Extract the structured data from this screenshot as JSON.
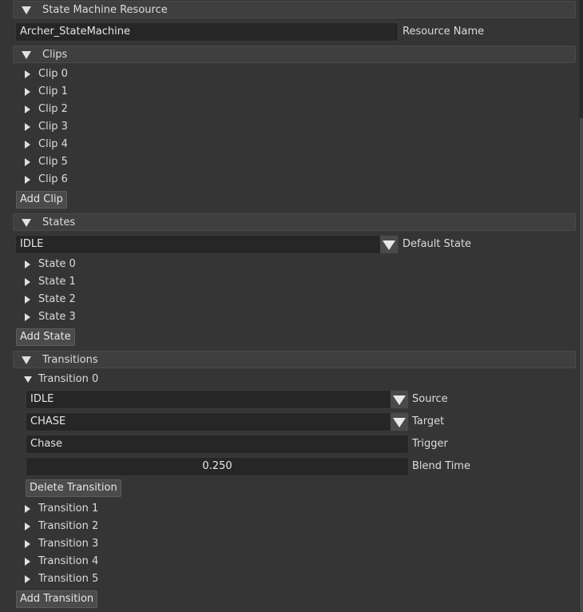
{
  "sections": {
    "resource": {
      "title": "State Machine Resource",
      "name_value": "Archer_StateMachine",
      "name_label": "Resource Name"
    },
    "clips": {
      "title": "Clips",
      "items": [
        "Clip 0",
        "Clip 1",
        "Clip 2",
        "Clip 3",
        "Clip 4",
        "Clip 5",
        "Clip 6"
      ],
      "add_label": "Add Clip"
    },
    "states": {
      "title": "States",
      "default_value": "IDLE",
      "default_label": "Default State",
      "items": [
        "State 0",
        "State 1",
        "State 2",
        "State 3"
      ],
      "add_label": "Add State"
    },
    "transitions": {
      "title": "Transitions",
      "expanded": {
        "label": "Transition 0",
        "source_value": "IDLE",
        "source_label": "Source",
        "target_value": "CHASE",
        "target_label": "Target",
        "trigger_value": "Chase",
        "trigger_label": "Trigger",
        "blend_value": "0.250",
        "blend_label": "Blend Time",
        "delete_label": "Delete Transition"
      },
      "items": [
        "Transition 1",
        "Transition 2",
        "Transition 3",
        "Transition 4",
        "Transition 5"
      ],
      "add_label": "Add Transition"
    }
  },
  "icons": {
    "expanded": "triangle-down-icon",
    "collapsed": "triangle-right-icon",
    "dropdown": "chevron-down-icon"
  }
}
